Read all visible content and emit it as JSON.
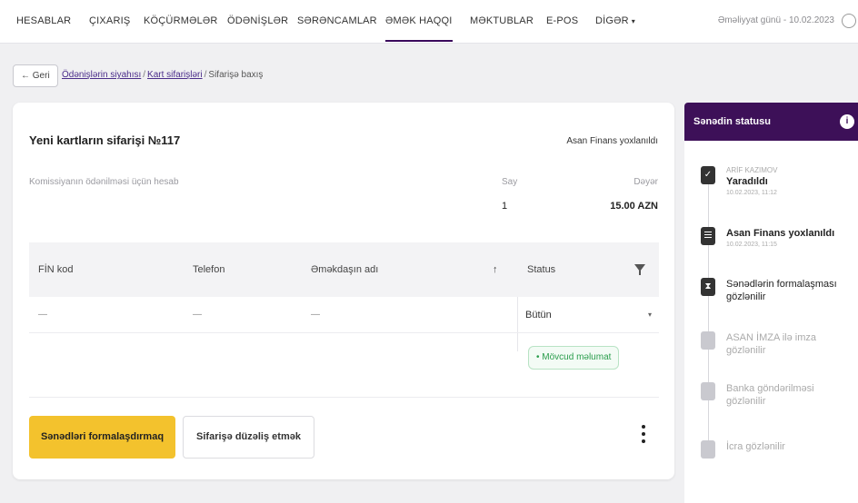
{
  "nav": {
    "items": [
      "HESABLAR",
      "ÇIXARIŞ",
      "KÖÇÜRMƏLƏR",
      "ÖDƏNİŞLƏR",
      "SƏRƏNCAMLAR",
      "ƏMƏK HAQQI",
      "MƏKTUBLAR",
      "E-POS",
      "DİGƏR"
    ],
    "active": "ƏMƏK HAQQI",
    "operational_day": "Əməliyyat günü - 10.02.2023"
  },
  "back_label": "← Geri",
  "breadcrumb": {
    "link1": "Ödənişlərin siyahısı",
    "sep": "/",
    "link2": "Kart sifarişləri",
    "current": "Sifarişə baxış"
  },
  "order": {
    "title": "Yeni kartların sifarişi №117",
    "approval": "Asan Finans yoxlanıldı",
    "commission_label": "Komissiyanın ödənilməsi üçün hesab",
    "count_label": "Say",
    "count_value": "1",
    "price_label": "Dəyər",
    "price_value": "15.00 AZN"
  },
  "table": {
    "columns": [
      "FİN kod",
      "Telefon",
      "Əməkdaşın adı",
      "Status"
    ],
    "sort_icon": "↑",
    "row": {
      "fin": "—",
      "phone": "—",
      "name": "—"
    },
    "status_select": "Bütün",
    "badge": "• Mövcud məlumat"
  },
  "actions": {
    "primary": "Sənədləri formalaşdırmaq",
    "secondary": "Sifarişə düzəliş etmək"
  },
  "status_panel": {
    "title": "Sənədin statusu",
    "info": "i",
    "steps": [
      {
        "person": "ARİF KAZIMOV",
        "label": "Yaradıldı",
        "date": "10.02.2023, 11:12"
      },
      {
        "label": "Asan Finans yoxlanıldı",
        "date": "10.02.2023, 11:15"
      },
      {
        "label": "Sənədlərin formalaşması gözlənilir"
      },
      {
        "label": "ASAN İMZA ilə imza gözlənilir"
      },
      {
        "label": "Banka göndərilməsi gözlənilir"
      },
      {
        "label": "İcra gözlənilir"
      }
    ]
  },
  "colors": {
    "brand": "#3d1058",
    "primary_button": "#f3c22d",
    "success": "#2a9d4c"
  }
}
